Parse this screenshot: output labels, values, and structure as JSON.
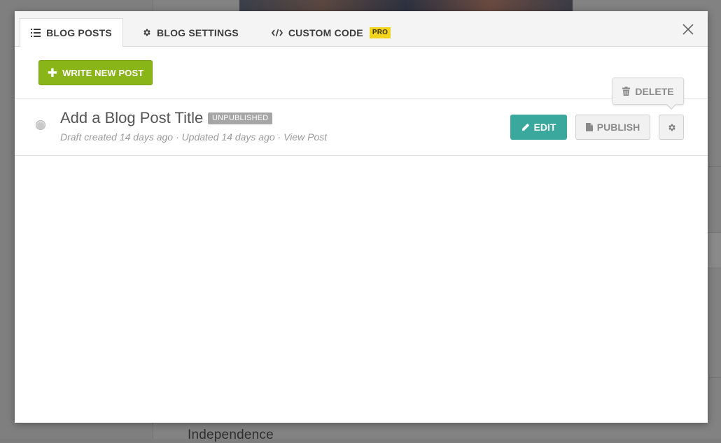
{
  "background": {
    "footer_text": "Independence"
  },
  "tabs": [
    {
      "label": "BLOG POSTS",
      "icon": "list-icon",
      "active": true
    },
    {
      "label": "BLOG SETTINGS",
      "icon": "gear-icon",
      "active": false
    },
    {
      "label": "CUSTOM CODE",
      "icon": "code-icon",
      "active": false,
      "badge": "PRO"
    }
  ],
  "toolbar": {
    "write_label": "WRITE NEW POST",
    "write_icon": "plus-icon"
  },
  "post": {
    "title": "Add a Blog Post Title",
    "status_badge": "UNPUBLISHED",
    "meta_created": "Draft created 14 days ago",
    "meta_separator": " · ",
    "meta_updated": "Updated 14 days ago",
    "meta_view": "View Post",
    "edit_label": "EDIT",
    "publish_label": "PUBLISH",
    "delete_label": "DELETE"
  },
  "colors": {
    "write_button": "#89b519",
    "edit_button": "#3aa89c",
    "pro_badge": "#f2d41c",
    "unpublished_badge": "#a6a6a6"
  }
}
